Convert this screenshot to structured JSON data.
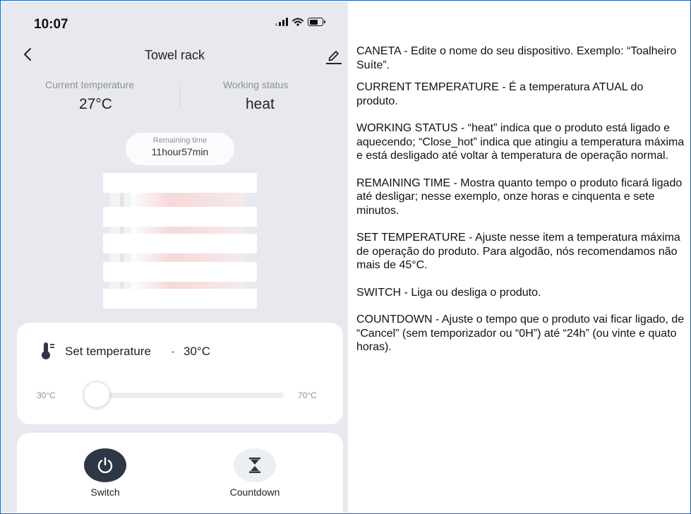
{
  "status_bar": {
    "time": "10:07"
  },
  "nav": {
    "title": "Towel rack"
  },
  "current_temperature": {
    "label": "Current temperature",
    "value": "27°C"
  },
  "working_status": {
    "label": "Working status",
    "value": "heat"
  },
  "remaining_time": {
    "label": "Remaining time",
    "value": "11hour57min"
  },
  "set_temperature": {
    "label": "Set temperature",
    "separator": "·",
    "value": "30°C",
    "min_label": "30°C",
    "max_label": "70°C",
    "slider_value": 30,
    "slider_min": 30,
    "slider_max": 70
  },
  "controls": {
    "switch_label": "Switch",
    "countdown_label": "Countdown"
  },
  "colors": {
    "accent_dark": "#2e3745",
    "panel_bg": "#e7e9ee",
    "card_bg": "#ffffff",
    "rack_heat": "#f7d2d2"
  },
  "notes": [
    "CANETA - Edite o nome do seu dispositivo.  Exemplo: “Toalheiro Suíte”.",
    "CURRENT TEMPERATURE - É a temperatura ATUAL do produto.",
    "WORKING STATUS - “heat” indica que o produto está ligado e aquecendo; “Close_hot” indica que atingiu a temperatura máxima e está desligado até voltar à temperatura de operação normal.",
    "REMAINING TIME - Mostra  quanto tempo  o produto ficará ligado até desligar; nesse exemplo, onze horas e cinquenta e sete minutos.",
    "SET TEMPERATURE - Ajuste nesse item a temperatura máxima de operação do produto.  Para algodão, nós recomendamos não mais de 45°C.",
    "SWITCH - Liga ou desliga o produto.",
    "COUNTDOWN - Ajuste  o tempo  que o  produto  vai ficar ligado, de “Cancel” (sem temporizador ou “0H”) até “24h” (ou vinte e quato horas)."
  ]
}
